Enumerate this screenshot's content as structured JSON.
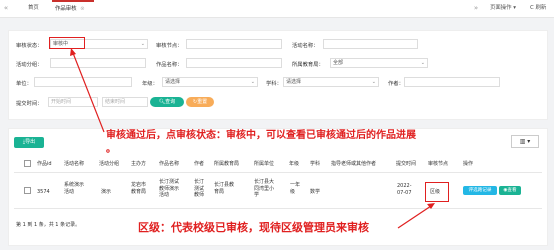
{
  "tabs": {
    "home": "首页",
    "active": "作品审核",
    "page_ops": "页面操作",
    "refresh": "C 刷新"
  },
  "search": {
    "status_label": "审核状态：",
    "status_value": "审核中",
    "node_label": "审核节点：",
    "activity_name_label": "活动名称：",
    "activity_group_label": "活动分组：",
    "work_name_label": "作品名称：",
    "edu_bureau_label": "所属教育局：",
    "edu_bureau_value": "全部",
    "unit_label": "单位：",
    "grade_label": "年级：",
    "grade_value": "请选择",
    "subject_label": "学科：",
    "subject_value": "请选择",
    "author_label": "作者：",
    "submit_time_label": "提交时间：",
    "start_placeholder": "开始时间",
    "end_placeholder": "结束时间",
    "query_label": "查询",
    "reset_label": "重置"
  },
  "toolbar": {
    "export_label": "导出",
    "columns_label": "▥ ▾"
  },
  "table": {
    "headers": [
      "作品id",
      "活动名称",
      "活动分组",
      "主办方",
      "作品名称",
      "作者",
      "所属教育局",
      "所属单位",
      "年级",
      "学科",
      "指导老师或其他作者",
      "提交时间",
      "审核节点",
      "操作"
    ],
    "rows": [
      {
        "id": "3574",
        "activity": [
          "系统演示",
          "活动"
        ],
        "group": "演示",
        "host": [
          "龙岩市",
          "教育局"
        ],
        "work": [
          "长汀测试",
          "教师演示",
          "活动"
        ],
        "author": [
          "长汀",
          "测试",
          "教师"
        ],
        "bureau": [
          "长汀县教",
          "育局"
        ],
        "unit": [
          "长汀县大",
          "同湾里小",
          "学"
        ],
        "grade": [
          "一年",
          "级"
        ],
        "subject": "数学",
        "advisor": "",
        "time": [
          "2022-",
          "07-07"
        ],
        "node": "区级",
        "op_log": "评选路记录",
        "op_view": "查看"
      }
    ],
    "footer": "第 1 到 1 条，共 1 条记录。"
  },
  "annotations": {
    "top": "审核通过后，点审核状态：审核中，可以查看已审核通过后的作品进展",
    "top_dot": "。",
    "bottom": "区级：代表校级已审核，现待区级管理员来审核"
  },
  "colors": {
    "accent_red": "#e02020",
    "primary_green": "#1ab394",
    "warning_orange": "#f8ac59",
    "info_blue": "#23b7e5"
  }
}
